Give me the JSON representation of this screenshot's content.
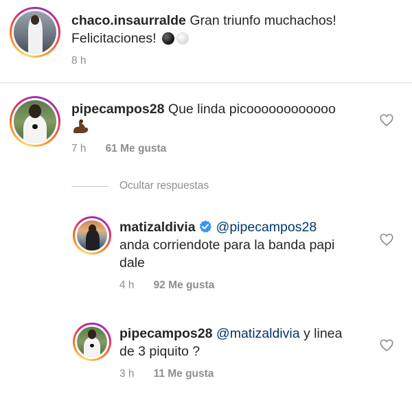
{
  "comments": [
    {
      "username": "chaco.insaurralde",
      "text_line1": " Gran triunfo muchachos!",
      "text_line2": "Felicitaciones!",
      "emojis": [
        "black-ball",
        "white-ball"
      ],
      "time": "8 h"
    },
    {
      "username": "pipecampos28",
      "text_line1": " Que linda picoooooooooooo",
      "emojis": [
        "flexed-biceps"
      ],
      "time": "7 h",
      "likes": "61 Me gusta"
    }
  ],
  "replies_toggle": "Ocultar respuestas",
  "replies": [
    {
      "username": "matizaldivia",
      "verified": true,
      "mention": "@pipecampos28",
      "text_line2": "anda corriendote para la banda papi",
      "text_line3": "dale",
      "time": "4 h",
      "likes": "92 Me gusta"
    },
    {
      "username": "pipecampos28",
      "mention": "@matizaldivia",
      "text_line1_rest": " y linea",
      "text_line2": "de 3 piquito ?",
      "time": "3 h",
      "likes": "11 Me gusta"
    }
  ],
  "colors": {
    "text": "#262626",
    "secondary": "#8e8e8e",
    "mention": "#00376b",
    "verified": "#3897f0"
  },
  "icons": [
    "heart-outline-icon",
    "verified-badge-icon"
  ]
}
